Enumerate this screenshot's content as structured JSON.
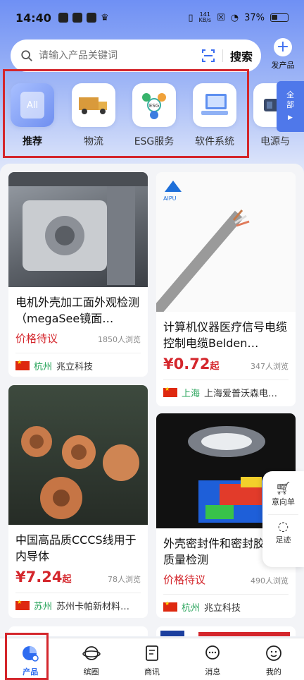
{
  "status": {
    "time": "14:40",
    "speed": "141\nKB/s",
    "battery": "37%"
  },
  "search": {
    "placeholder": "请输入产品关键词",
    "button": "搜索"
  },
  "post_product": {
    "label": "发产品"
  },
  "categories": [
    {
      "label": "推荐",
      "icon": "all-icon",
      "icon_text": "All",
      "active": true
    },
    {
      "label": "物流",
      "icon": "truck-icon"
    },
    {
      "label": "ESG服务",
      "icon": "esg-icon",
      "icon_text": "ESG"
    },
    {
      "label": "软件系统",
      "icon": "software-icon"
    },
    {
      "label": "电源与",
      "icon": "power-icon"
    }
  ],
  "all_tab": {
    "line1": "全",
    "line2": "部"
  },
  "products": [
    {
      "title": "电机外壳加工面外观检测（megaSee镜面…",
      "price_text": "价格待议",
      "views": "1850人浏览",
      "city": "杭州",
      "seller": "兆立科技"
    },
    {
      "title": "计算机仪器医疗信号电缆控制电缆Belden…",
      "price": "¥0.72",
      "price_unit": "起",
      "views": "347人浏览",
      "city": "上海",
      "seller": "上海爱普沃森电…",
      "brand": "AIPU"
    },
    {
      "title": "中国高品质CCCS线用于内导体",
      "price": "¥7.24",
      "price_unit": "起",
      "views": "78人浏览",
      "city": "苏州",
      "seller": "苏州卡帕新材料…"
    },
    {
      "title": "外壳密封件和密封胶涂敷质量检测",
      "price_text": "价格待议",
      "views": "490人浏览",
      "city": "杭州",
      "seller": "兆立科技"
    }
  ],
  "floating": {
    "cart": "意向单",
    "footprint": "足迹"
  },
  "nav": [
    {
      "label": "产品",
      "icon": "product-icon",
      "active": true
    },
    {
      "label": "缤圈",
      "icon": "planet-icon"
    },
    {
      "label": "商讯",
      "icon": "news-icon"
    },
    {
      "label": "消息",
      "icon": "message-icon"
    },
    {
      "label": "我的",
      "icon": "profile-icon"
    }
  ],
  "colors": {
    "accent": "#2e6cf0",
    "price_red": "#d4262c",
    "city_green": "#2ba55d",
    "highlight_red": "#d4262c"
  }
}
